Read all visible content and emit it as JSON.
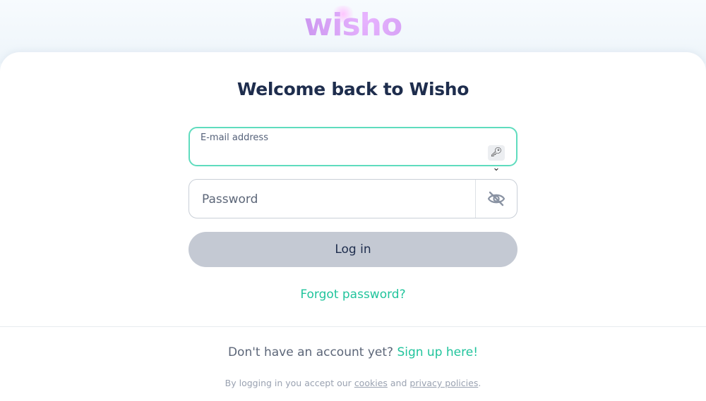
{
  "brand": {
    "logo_text": "wisho",
    "logo_color": "#a06ad6"
  },
  "login": {
    "title": "Welcome back to Wisho",
    "email": {
      "label": "E-mail address",
      "value": "",
      "key_icon": "key-icon",
      "key_glyph": "🔑︎⌄"
    },
    "password": {
      "placeholder": "Password",
      "value": "",
      "toggle_icon": "eye-slash-icon"
    },
    "login_button_label": "Log in",
    "forgot_password": "Forgot password?"
  },
  "footer": {
    "no_account_text": "Don't have an account yet?",
    "signup_link": "Sign up here!",
    "legal_prefix": "By logging in you accept our",
    "cookies_link": "cookies",
    "legal_and": "and",
    "privacy_link": "privacy policies",
    "legal_suffix": "."
  },
  "colors": {
    "accent": "#21c49c",
    "focus_border": "#5fdcbe",
    "heading": "#1e2d4d",
    "button_disabled": "#c4c9d3"
  }
}
